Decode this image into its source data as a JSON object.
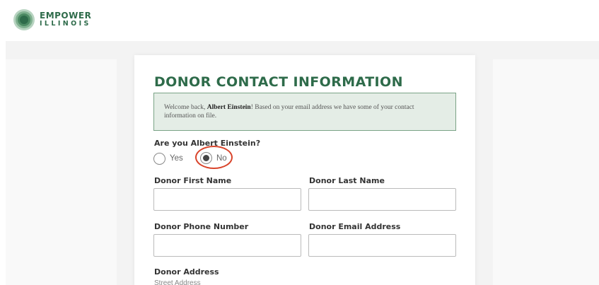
{
  "brand": {
    "line1": "EMPOWER",
    "line2": "ILLINOIS",
    "color": "#2e6b4a"
  },
  "form": {
    "title": "DONOR CONTACT INFORMATION",
    "notice": {
      "prefix": "Welcome back, ",
      "name": "Albert Einstein",
      "suffix": "! Based on your email address we have some of your contact information on file."
    },
    "identity_question": "Are you Albert Einstein?",
    "options": {
      "yes": "Yes",
      "no": "No",
      "selected": "No"
    },
    "first_name_label": "Donor First Name",
    "last_name_label": "Donor Last Name",
    "phone_label": "Donor Phone Number",
    "email_label": "Donor Email Address",
    "address_label": "Donor Address",
    "street_label": "Street Address",
    "first_name_value": "",
    "last_name_value": "",
    "phone_value": "",
    "email_value": ""
  },
  "colors": {
    "accent": "#2e6b4a",
    "highlight": "#d9442b",
    "notice_bg": "#e4ede6"
  }
}
